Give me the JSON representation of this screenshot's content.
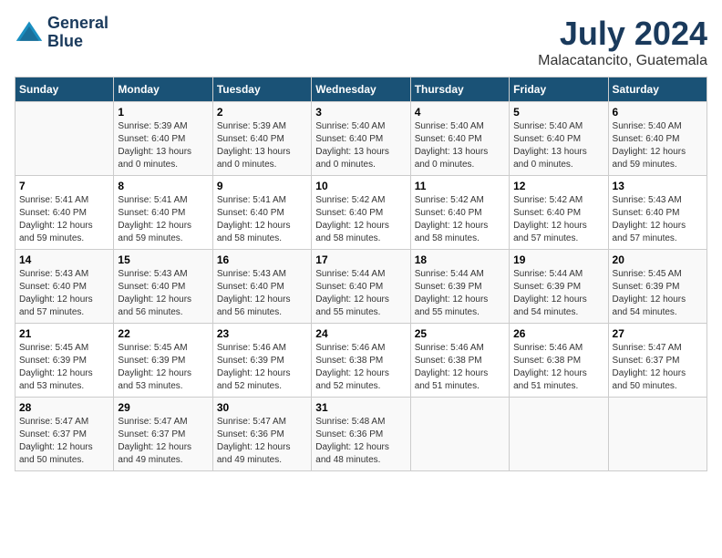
{
  "header": {
    "logo_line1": "General",
    "logo_line2": "Blue",
    "month_title": "July 2024",
    "location": "Malacatancito, Guatemala"
  },
  "weekdays": [
    "Sunday",
    "Monday",
    "Tuesday",
    "Wednesday",
    "Thursday",
    "Friday",
    "Saturday"
  ],
  "weeks": [
    [
      {
        "day": "",
        "sunrise": "",
        "sunset": "",
        "daylight": ""
      },
      {
        "day": "1",
        "sunrise": "Sunrise: 5:39 AM",
        "sunset": "Sunset: 6:40 PM",
        "daylight": "Daylight: 13 hours and 0 minutes."
      },
      {
        "day": "2",
        "sunrise": "Sunrise: 5:39 AM",
        "sunset": "Sunset: 6:40 PM",
        "daylight": "Daylight: 13 hours and 0 minutes."
      },
      {
        "day": "3",
        "sunrise": "Sunrise: 5:40 AM",
        "sunset": "Sunset: 6:40 PM",
        "daylight": "Daylight: 13 hours and 0 minutes."
      },
      {
        "day": "4",
        "sunrise": "Sunrise: 5:40 AM",
        "sunset": "Sunset: 6:40 PM",
        "daylight": "Daylight: 13 hours and 0 minutes."
      },
      {
        "day": "5",
        "sunrise": "Sunrise: 5:40 AM",
        "sunset": "Sunset: 6:40 PM",
        "daylight": "Daylight: 13 hours and 0 minutes."
      },
      {
        "day": "6",
        "sunrise": "Sunrise: 5:40 AM",
        "sunset": "Sunset: 6:40 PM",
        "daylight": "Daylight: 12 hours and 59 minutes."
      }
    ],
    [
      {
        "day": "7",
        "sunrise": "Sunrise: 5:41 AM",
        "sunset": "Sunset: 6:40 PM",
        "daylight": "Daylight: 12 hours and 59 minutes."
      },
      {
        "day": "8",
        "sunrise": "Sunrise: 5:41 AM",
        "sunset": "Sunset: 6:40 PM",
        "daylight": "Daylight: 12 hours and 59 minutes."
      },
      {
        "day": "9",
        "sunrise": "Sunrise: 5:41 AM",
        "sunset": "Sunset: 6:40 PM",
        "daylight": "Daylight: 12 hours and 58 minutes."
      },
      {
        "day": "10",
        "sunrise": "Sunrise: 5:42 AM",
        "sunset": "Sunset: 6:40 PM",
        "daylight": "Daylight: 12 hours and 58 minutes."
      },
      {
        "day": "11",
        "sunrise": "Sunrise: 5:42 AM",
        "sunset": "Sunset: 6:40 PM",
        "daylight": "Daylight: 12 hours and 58 minutes."
      },
      {
        "day": "12",
        "sunrise": "Sunrise: 5:42 AM",
        "sunset": "Sunset: 6:40 PM",
        "daylight": "Daylight: 12 hours and 57 minutes."
      },
      {
        "day": "13",
        "sunrise": "Sunrise: 5:43 AM",
        "sunset": "Sunset: 6:40 PM",
        "daylight": "Daylight: 12 hours and 57 minutes."
      }
    ],
    [
      {
        "day": "14",
        "sunrise": "Sunrise: 5:43 AM",
        "sunset": "Sunset: 6:40 PM",
        "daylight": "Daylight: 12 hours and 57 minutes."
      },
      {
        "day": "15",
        "sunrise": "Sunrise: 5:43 AM",
        "sunset": "Sunset: 6:40 PM",
        "daylight": "Daylight: 12 hours and 56 minutes."
      },
      {
        "day": "16",
        "sunrise": "Sunrise: 5:43 AM",
        "sunset": "Sunset: 6:40 PM",
        "daylight": "Daylight: 12 hours and 56 minutes."
      },
      {
        "day": "17",
        "sunrise": "Sunrise: 5:44 AM",
        "sunset": "Sunset: 6:40 PM",
        "daylight": "Daylight: 12 hours and 55 minutes."
      },
      {
        "day": "18",
        "sunrise": "Sunrise: 5:44 AM",
        "sunset": "Sunset: 6:39 PM",
        "daylight": "Daylight: 12 hours and 55 minutes."
      },
      {
        "day": "19",
        "sunrise": "Sunrise: 5:44 AM",
        "sunset": "Sunset: 6:39 PM",
        "daylight": "Daylight: 12 hours and 54 minutes."
      },
      {
        "day": "20",
        "sunrise": "Sunrise: 5:45 AM",
        "sunset": "Sunset: 6:39 PM",
        "daylight": "Daylight: 12 hours and 54 minutes."
      }
    ],
    [
      {
        "day": "21",
        "sunrise": "Sunrise: 5:45 AM",
        "sunset": "Sunset: 6:39 PM",
        "daylight": "Daylight: 12 hours and 53 minutes."
      },
      {
        "day": "22",
        "sunrise": "Sunrise: 5:45 AM",
        "sunset": "Sunset: 6:39 PM",
        "daylight": "Daylight: 12 hours and 53 minutes."
      },
      {
        "day": "23",
        "sunrise": "Sunrise: 5:46 AM",
        "sunset": "Sunset: 6:39 PM",
        "daylight": "Daylight: 12 hours and 52 minutes."
      },
      {
        "day": "24",
        "sunrise": "Sunrise: 5:46 AM",
        "sunset": "Sunset: 6:38 PM",
        "daylight": "Daylight: 12 hours and 52 minutes."
      },
      {
        "day": "25",
        "sunrise": "Sunrise: 5:46 AM",
        "sunset": "Sunset: 6:38 PM",
        "daylight": "Daylight: 12 hours and 51 minutes."
      },
      {
        "day": "26",
        "sunrise": "Sunrise: 5:46 AM",
        "sunset": "Sunset: 6:38 PM",
        "daylight": "Daylight: 12 hours and 51 minutes."
      },
      {
        "day": "27",
        "sunrise": "Sunrise: 5:47 AM",
        "sunset": "Sunset: 6:37 PM",
        "daylight": "Daylight: 12 hours and 50 minutes."
      }
    ],
    [
      {
        "day": "28",
        "sunrise": "Sunrise: 5:47 AM",
        "sunset": "Sunset: 6:37 PM",
        "daylight": "Daylight: 12 hours and 50 minutes."
      },
      {
        "day": "29",
        "sunrise": "Sunrise: 5:47 AM",
        "sunset": "Sunset: 6:37 PM",
        "daylight": "Daylight: 12 hours and 49 minutes."
      },
      {
        "day": "30",
        "sunrise": "Sunrise: 5:47 AM",
        "sunset": "Sunset: 6:36 PM",
        "daylight": "Daylight: 12 hours and 49 minutes."
      },
      {
        "day": "31",
        "sunrise": "Sunrise: 5:48 AM",
        "sunset": "Sunset: 6:36 PM",
        "daylight": "Daylight: 12 hours and 48 minutes."
      },
      {
        "day": "",
        "sunrise": "",
        "sunset": "",
        "daylight": ""
      },
      {
        "day": "",
        "sunrise": "",
        "sunset": "",
        "daylight": ""
      },
      {
        "day": "",
        "sunrise": "",
        "sunset": "",
        "daylight": ""
      }
    ]
  ]
}
